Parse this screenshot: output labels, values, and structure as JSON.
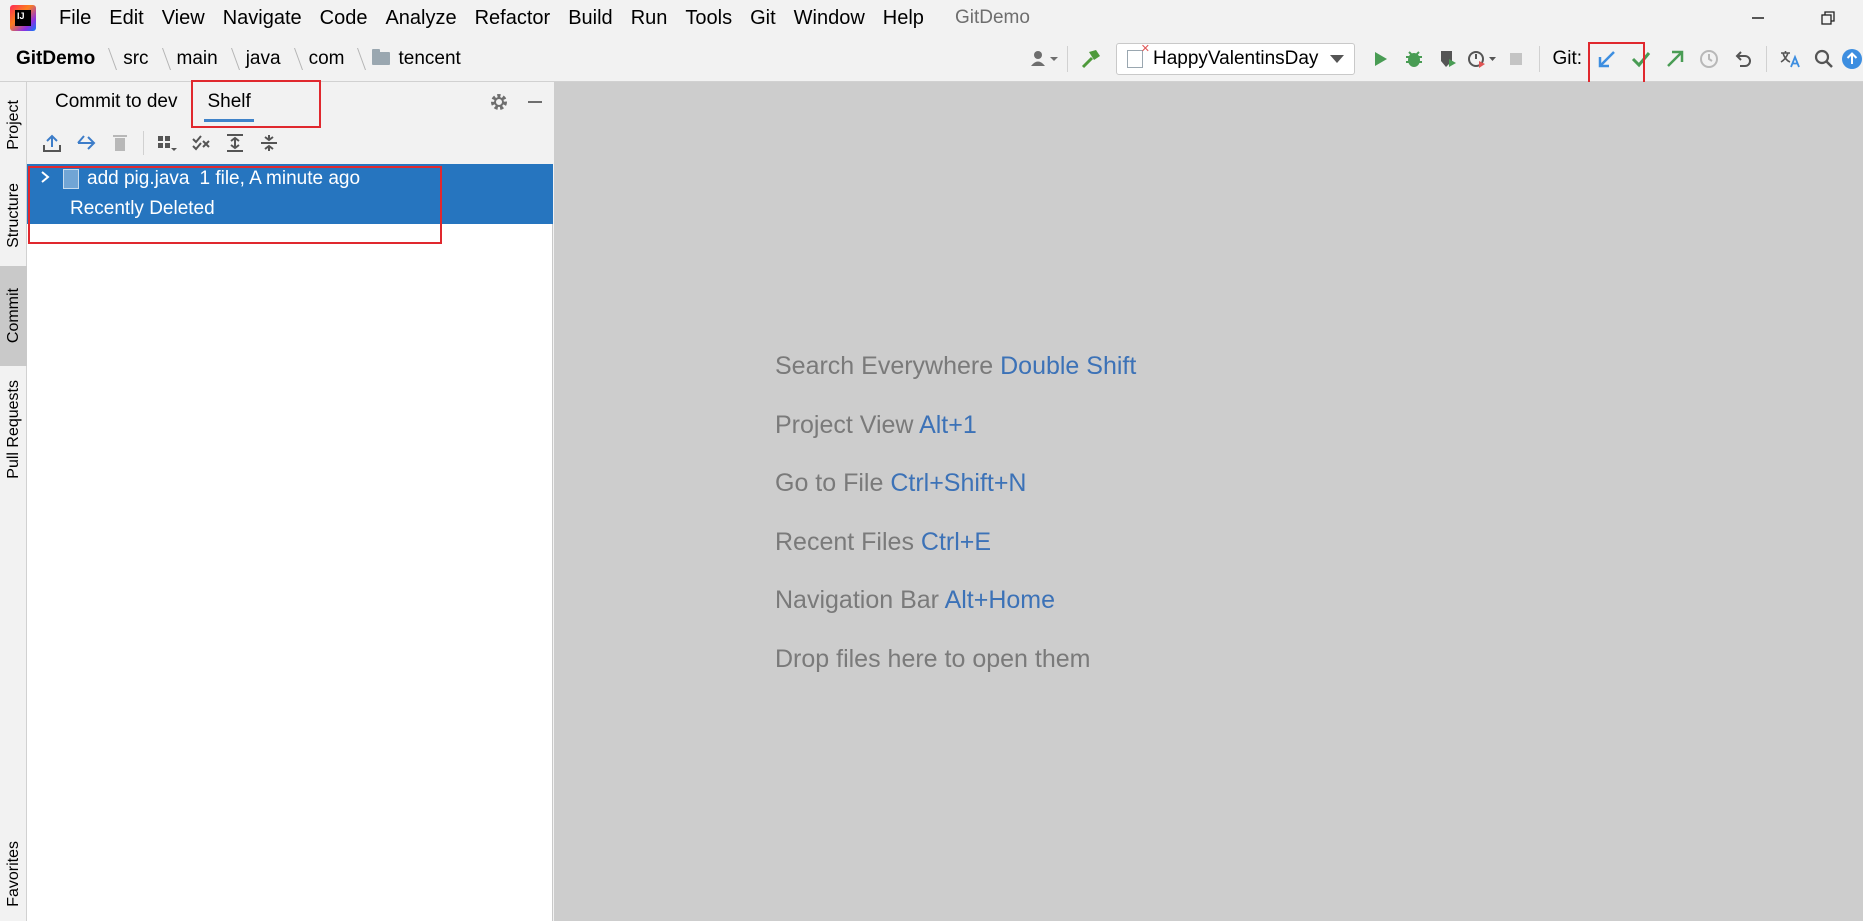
{
  "app": {
    "logo_text": "IJ",
    "window_title": "GitDemo",
    "colors": {
      "accent": "#2675bf",
      "highlight_box": "#e0282e",
      "editor_bg": "#cdcdcd",
      "shortcut": "#3c72b7"
    }
  },
  "menu": [
    {
      "label": "File"
    },
    {
      "label": "Edit"
    },
    {
      "label": "View"
    },
    {
      "label": "Navigate"
    },
    {
      "label": "Code"
    },
    {
      "label": "Analyze"
    },
    {
      "label": "Refactor"
    },
    {
      "label": "Build"
    },
    {
      "label": "Run"
    },
    {
      "label": "Tools"
    },
    {
      "label": "Git"
    },
    {
      "label": "Window"
    },
    {
      "label": "Help"
    }
  ],
  "breadcrumb": [
    {
      "label": "GitDemo"
    },
    {
      "label": "src"
    },
    {
      "label": "main"
    },
    {
      "label": "java"
    },
    {
      "label": "com"
    },
    {
      "label": "tencent",
      "icon": "folder-icon"
    }
  ],
  "toolbar": {
    "run_config": "HappyValentinsDay",
    "git_label": "Git:"
  },
  "left_stripe": [
    {
      "label": "Project"
    },
    {
      "label": "Structure"
    },
    {
      "label": "Commit",
      "active": true
    },
    {
      "label": "Pull Requests"
    },
    {
      "label": "Favorites"
    }
  ],
  "panel": {
    "tabs": [
      {
        "label": "Commit to dev",
        "selected": false
      },
      {
        "label": "Shelf",
        "selected": true
      }
    ]
  },
  "shelf": {
    "items": [
      {
        "name": "add pig.java",
        "meta": "1 file, A minute ago"
      }
    ],
    "recently_deleted": "Recently Deleted"
  },
  "editor": {
    "hints": [
      {
        "text": "Search Everywhere",
        "key": "Double Shift"
      },
      {
        "text": "Project View",
        "key": "Alt+1"
      },
      {
        "text": "Go to File",
        "key": "Ctrl+Shift+N"
      },
      {
        "text": "Recent Files",
        "key": "Ctrl+E"
      },
      {
        "text": "Navigation Bar",
        "key": "Alt+Home"
      },
      {
        "text": "Drop files here to open them",
        "key": ""
      }
    ]
  }
}
